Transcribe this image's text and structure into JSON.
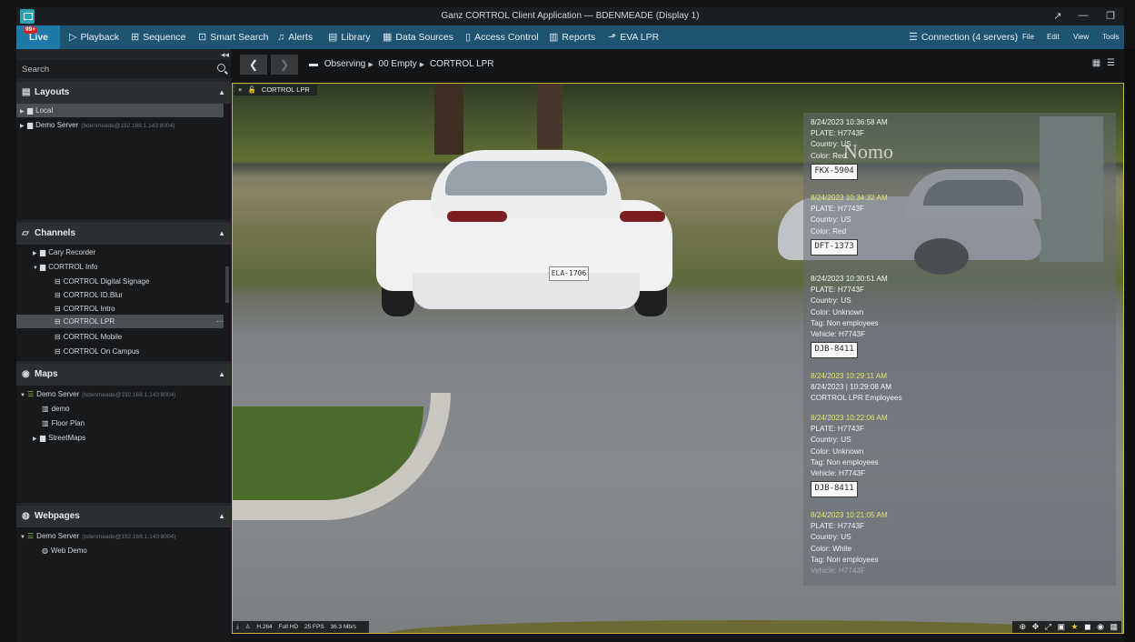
{
  "window": {
    "title": "Ganz CORTROL Client Application — BDENMEADE (Display 1)",
    "controls": [
      "↗",
      "—",
      "❐"
    ]
  },
  "navbar": {
    "live": {
      "label": "Live",
      "badge": "99+"
    },
    "items": [
      {
        "label": "Playback",
        "icon": "play-icon"
      },
      {
        "label": "Sequence",
        "icon": "sequence-icon"
      },
      {
        "label": "Smart Search",
        "icon": "smart-search-icon"
      },
      {
        "label": "Alerts",
        "icon": "bell-icon"
      },
      {
        "label": "Library",
        "icon": "library-icon"
      },
      {
        "label": "Data Sources",
        "icon": "data-sources-icon"
      },
      {
        "label": "Access Control",
        "icon": "door-icon"
      },
      {
        "label": "Reports",
        "icon": "chart-icon"
      },
      {
        "label": "EVA LPR",
        "icon": "lpr-icon"
      }
    ],
    "right": [
      {
        "label": "Connection (4 servers)",
        "icon": "server-stack-icon"
      },
      {
        "label": "File"
      },
      {
        "label": "Edit"
      },
      {
        "label": "View"
      },
      {
        "label": "Tools"
      }
    ]
  },
  "sidebar": {
    "search": {
      "placeholder": "Search",
      "value": ""
    },
    "layouts": {
      "title": "Layouts",
      "items": [
        {
          "label": "Local",
          "muted": ""
        },
        {
          "label": "Demo Server",
          "muted": "(bdenmeade@192.168.1.143:8004)"
        }
      ]
    },
    "channels": {
      "title": "Channels",
      "items": [
        {
          "label": "Cary Recorder"
        },
        {
          "label": "CORTROL Info"
        },
        {
          "label": "CORTROL Digital Signage"
        },
        {
          "label": "CORTROL ID.Blur"
        },
        {
          "label": "CORTROL Intro"
        },
        {
          "label": "CORTROL LPR",
          "extra": "···"
        },
        {
          "label": "CORTROL Mobile"
        },
        {
          "label": "CORTROL On Campus"
        }
      ]
    },
    "maps": {
      "title": "Maps",
      "items": [
        {
          "label": "Demo Server",
          "muted": "(bdenmeade@192.168.1.143:8004)"
        },
        {
          "label": "demo"
        },
        {
          "label": "Floor Plan"
        },
        {
          "label": "StreetMaps"
        }
      ]
    },
    "webpages": {
      "title": "Webpages",
      "items": [
        {
          "label": "Demo Server",
          "muted": "(bdenmeade@192.168.1.143:8004)"
        },
        {
          "label": "Web Demo"
        }
      ]
    }
  },
  "main": {
    "breadcrumb": [
      "Observing",
      "00 Empty",
      "CORTROL LPR"
    ],
    "tile": {
      "close": "×",
      "lock": "🔓",
      "title": "CORTROL LPR",
      "status": [
        "H.264",
        "Full HD",
        "25 FPS",
        "36.3 Mb/s"
      ],
      "tools": [
        "⊕",
        "✥",
        "⤢",
        "▣",
        "★",
        "◼",
        "◉",
        "▦"
      ]
    },
    "watermark": "Nomo",
    "scene": {
      "main_car_plate": "ELA-1706"
    },
    "lpr_events": [
      {
        "timestamp": "8/24/2023 10:36:58 AM",
        "ts_color": "white",
        "lines": [
          "PLATE: H7743F",
          "Country: US",
          "Color: Red"
        ],
        "plate": "FKX-5904"
      },
      {
        "timestamp": "8/24/2023 10:34:32 AM",
        "ts_color": "yellow",
        "lines": [
          "PLATE: H7743F",
          "Country: US",
          "Color: Red"
        ],
        "plate": "DFT-1373"
      },
      {
        "timestamp": "8/24/2023 10:30:51 AM",
        "ts_color": "white",
        "lines": [
          "PLATE: H7743F",
          "Country: US",
          "Color: Unknown",
          "Tag: Non employees",
          "Vehicle: H7743F"
        ],
        "plate": "DJB-8411"
      },
      {
        "timestamp": "8/24/2023 10:29:11 AM",
        "ts_color": "yellow",
        "lines": [
          "8/24/2023 | 10:29:08 AM",
          "CORTROL LPR Employees"
        ],
        "plate": ""
      },
      {
        "timestamp": "8/24/2023 10:22:06 AM",
        "ts_color": "yellow",
        "lines": [
          "PLATE: H7743F",
          "Country: US",
          "Color: Unknown",
          "Tag: Non employees",
          "Vehicle: H7743F"
        ],
        "plate": "DJB-8411"
      },
      {
        "timestamp": "8/24/2023 10:21:05 AM",
        "ts_color": "yellow",
        "lines": [
          "PLATE: H7743F",
          "Country: US",
          "Color: White",
          "Tag: Non employees",
          "Vehicle: H7743F"
        ],
        "plate": ""
      }
    ]
  },
  "colors": {
    "navbar": "#1e5372",
    "live_tab": "#1d7aa8",
    "tile_border": "#c9b53d",
    "timestamp_yellow": "#e4e76a",
    "server_green": "#7fbf39"
  }
}
